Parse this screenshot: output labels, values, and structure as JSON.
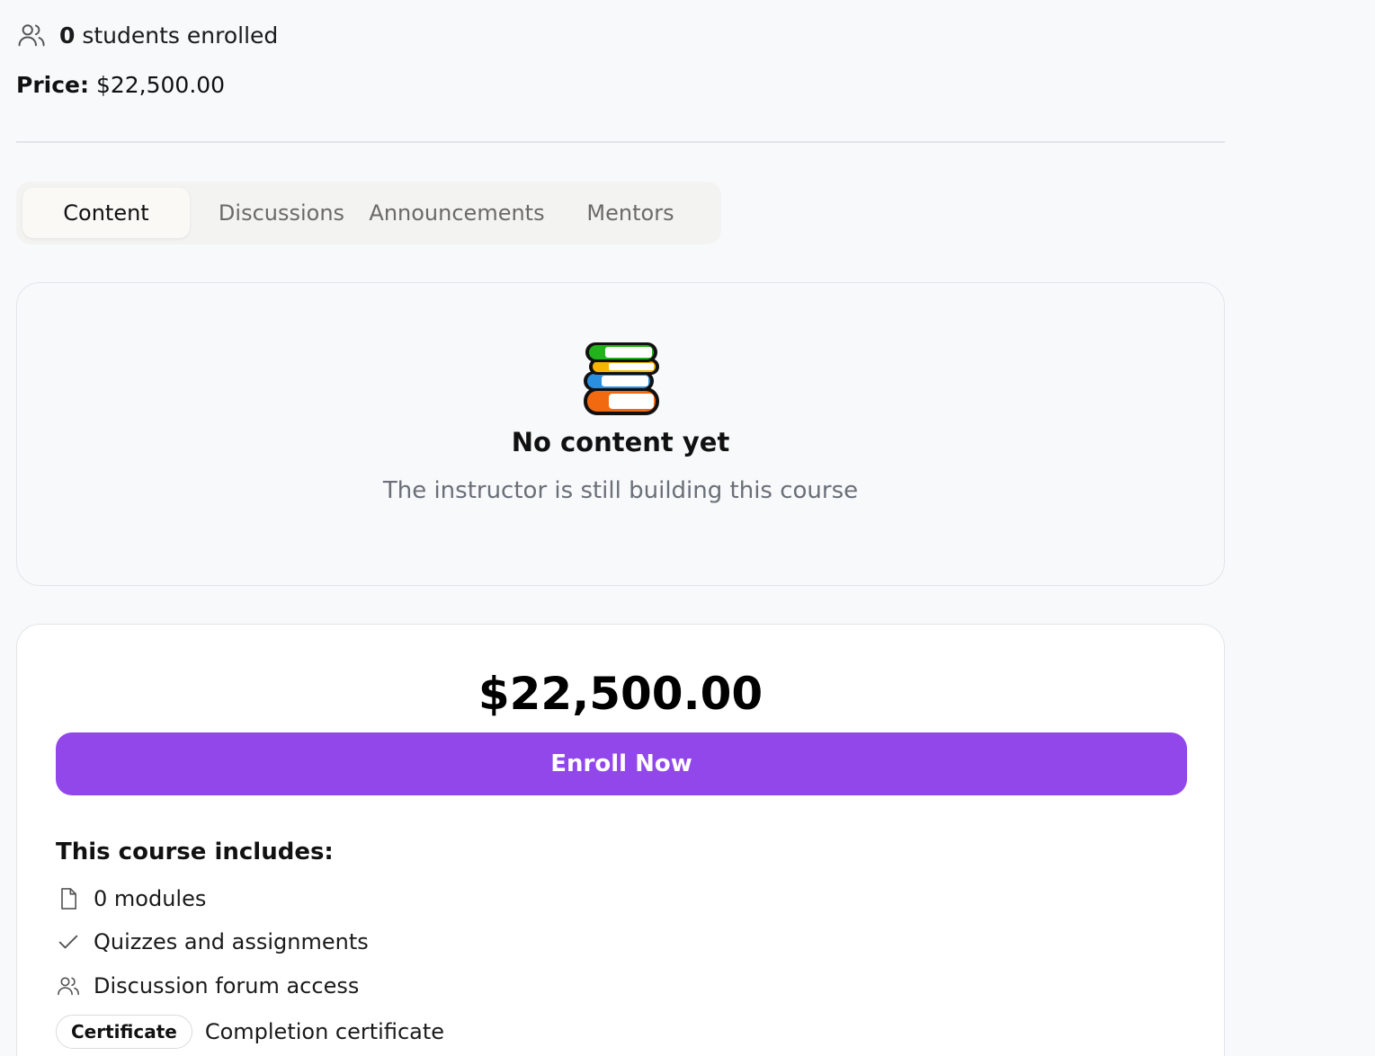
{
  "header": {
    "enrolled_count": "0",
    "enrolled_suffix": "students enrolled",
    "price_label": "Price:",
    "price_value": "$22,500.00"
  },
  "tabs": [
    {
      "label": "Content",
      "active": true
    },
    {
      "label": "Discussions",
      "active": false
    },
    {
      "label": "Announcements",
      "active": false
    },
    {
      "label": "Mentors",
      "active": false
    }
  ],
  "empty_state": {
    "icon": "books-icon",
    "title": "No content yet",
    "subtitle": "The instructor is still building this course"
  },
  "purchase": {
    "price": "$22,500.00",
    "enroll_label": "Enroll Now",
    "accent_color": "#9147ea",
    "includes_title": "This course includes:",
    "items": [
      {
        "icon": "document-icon",
        "text": "0 modules"
      },
      {
        "icon": "check-icon",
        "text": "Quizzes and assignments"
      },
      {
        "icon": "users-icon",
        "text": "Discussion forum access"
      },
      {
        "badge": "Certificate",
        "text": "Completion certificate"
      }
    ]
  }
}
